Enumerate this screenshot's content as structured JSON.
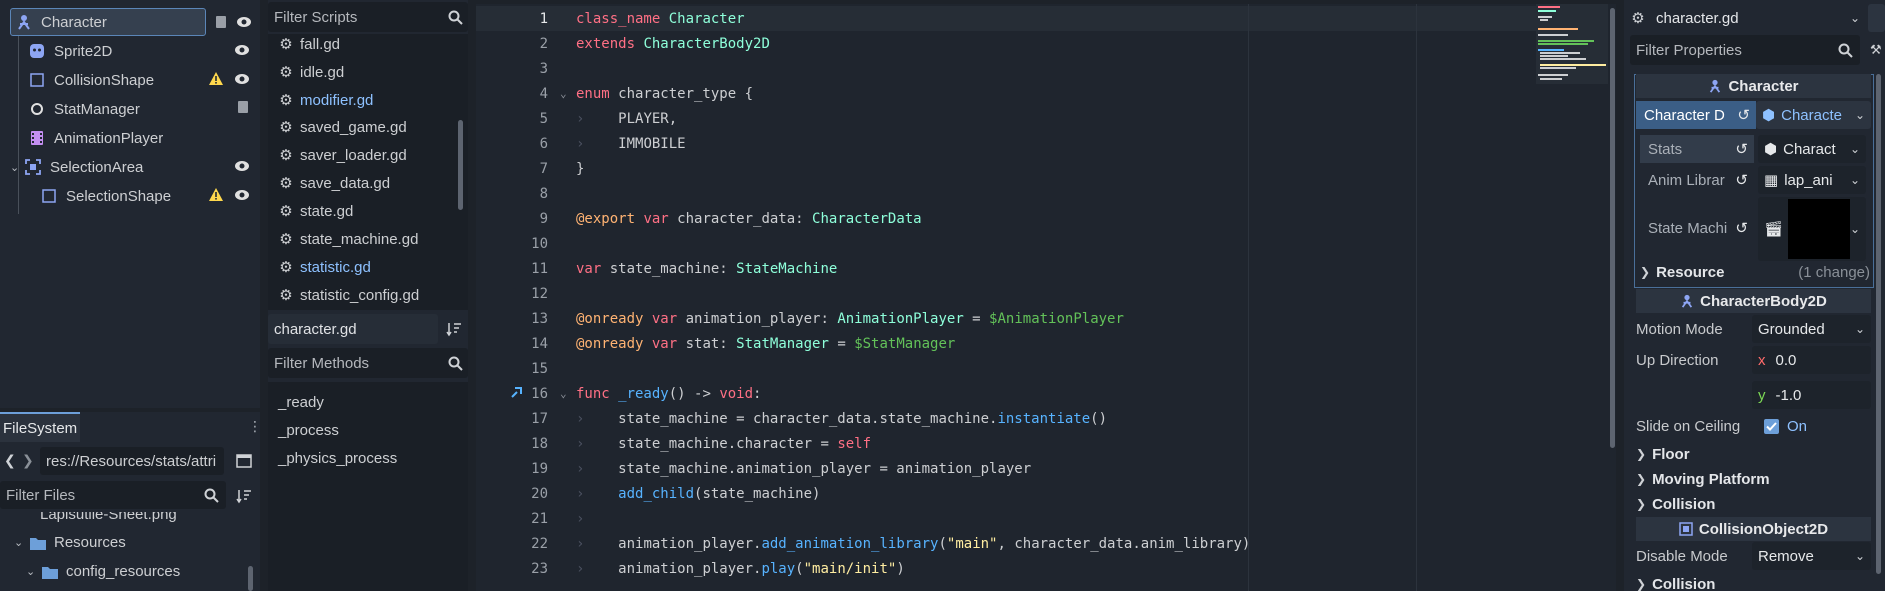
{
  "scene_tree": {
    "nodes": [
      {
        "label": "Character",
        "icon": "character-icon"
      },
      {
        "label": "Sprite2D",
        "icon": "sprite-icon"
      },
      {
        "label": "CollisionShape",
        "icon": "collision-shape-icon"
      },
      {
        "label": "StatManager",
        "icon": "node-circle-icon"
      },
      {
        "label": "AnimationPlayer",
        "icon": "animation-player-icon"
      },
      {
        "label": "SelectionArea",
        "icon": "area-icon"
      },
      {
        "label": "SelectionShape",
        "icon": "collision-shape-icon"
      }
    ]
  },
  "filesystem": {
    "tab_label": "FileSystem",
    "path": "res://Resources/stats/attri",
    "filter_placeholder": "Filter Files",
    "items": [
      {
        "label": "Lapisutile-Sheet.png"
      },
      {
        "label": "Resources"
      },
      {
        "label": "config_resources"
      }
    ]
  },
  "scripts_panel": {
    "filter_placeholder": "Filter Scripts",
    "items": [
      {
        "label": "fall.gd",
        "modified": false
      },
      {
        "label": "idle.gd",
        "modified": false
      },
      {
        "label": "modifier.gd",
        "modified": true
      },
      {
        "label": "saved_game.gd",
        "modified": false
      },
      {
        "label": "saver_loader.gd",
        "modified": false
      },
      {
        "label": "save_data.gd",
        "modified": false
      },
      {
        "label": "state.gd",
        "modified": false
      },
      {
        "label": "state_machine.gd",
        "modified": false
      },
      {
        "label": "statistic.gd",
        "modified": true
      },
      {
        "label": "statistic_config.gd",
        "modified": false
      }
    ],
    "current_script": "character.gd",
    "methods_placeholder": "Filter Methods",
    "methods": [
      "_ready",
      "_process",
      "_physics_process"
    ]
  },
  "editor": {
    "line_numbers": [
      "1",
      "2",
      "3",
      "4",
      "5",
      "6",
      "7",
      "8",
      "9",
      "10",
      "11",
      "12",
      "13",
      "14",
      "15",
      "16",
      "17",
      "18",
      "19",
      "20",
      "21",
      "22",
      "23"
    ],
    "line1": {
      "a": "class_name",
      "b": " Character"
    },
    "line2": {
      "a": "extends",
      "b": " CharacterBody2D"
    },
    "line4": {
      "a": "enum",
      "b": " character_type {"
    },
    "line5": "PLAYER,",
    "line6": "IMMOBILE",
    "line7": "}",
    "line9": {
      "a": "@export",
      "b": " var",
      "c": " character_data: ",
      "d": "CharacterData"
    },
    "line11": {
      "a": "var",
      "b": " state_machine: ",
      "c": "StateMachine"
    },
    "line13": {
      "a": "@onready",
      "b": " var",
      "c": " animation_player: ",
      "d": "AnimationPlayer",
      "e": " = ",
      "f": "$AnimationPlayer"
    },
    "line14": {
      "a": "@onready",
      "b": " var",
      "c": " stat: ",
      "d": "StatManager",
      "e": " = ",
      "f": "$StatManager"
    },
    "line16": {
      "a": "func",
      "b": " _ready",
      "c": "() -> ",
      "d": "void",
      "e": ":"
    },
    "line17": {
      "a": "state_machine = character_data.state_machine.",
      "b": "instantiate",
      "c": "()"
    },
    "line18": {
      "a": "state_machine.character = ",
      "b": "self"
    },
    "line19": "state_machine.animation_player = animation_player",
    "line20": {
      "a": "add_child",
      "b": "(state_machine)"
    },
    "line22": {
      "a": "animation_player.",
      "b": "add_animation_library",
      "c": "(",
      "d": "\"main\"",
      "e": ", character_data.anim_library)"
    },
    "line23": {
      "a": "animation_player.",
      "b": "play",
      "c": "(",
      "d": "\"main/init\"",
      "e": ")"
    }
  },
  "inspector": {
    "object_name": "character.gd",
    "filter_placeholder": "Filter Properties",
    "header_character": "Character",
    "prop_character_data": {
      "label": "Character D",
      "value": "Characte"
    },
    "prop_stats": {
      "label": "Stats",
      "value": "Charact"
    },
    "prop_anim_library": {
      "label": "Anim Librar",
      "value": "lap_ani"
    },
    "prop_state_machine": {
      "label": "State Machi"
    },
    "resource_section": {
      "label": "Resource",
      "note": "(1 change)"
    },
    "header_body": "CharacterBody2D",
    "motion_mode": {
      "label": "Motion Mode",
      "value": "Grounded"
    },
    "up_direction": {
      "label": "Up Direction",
      "x_label": "x",
      "x": "0.0",
      "y_label": "y",
      "y": "-1.0"
    },
    "slide_on_ceiling": {
      "label": "Slide on Ceiling",
      "value": "On"
    },
    "floor_label": "Floor",
    "moving_platform_label": "Moving Platform",
    "collision_label": "Collision",
    "header_collision_object": "CollisionObject2D",
    "disable_mode": {
      "label": "Disable Mode",
      "value": "Remove"
    },
    "collision_label2": "Collision"
  },
  "colors": {
    "accent": "#6d9fd9",
    "warning": "#ffd84d",
    "keyword": "#ff7085",
    "type": "#8effda"
  }
}
